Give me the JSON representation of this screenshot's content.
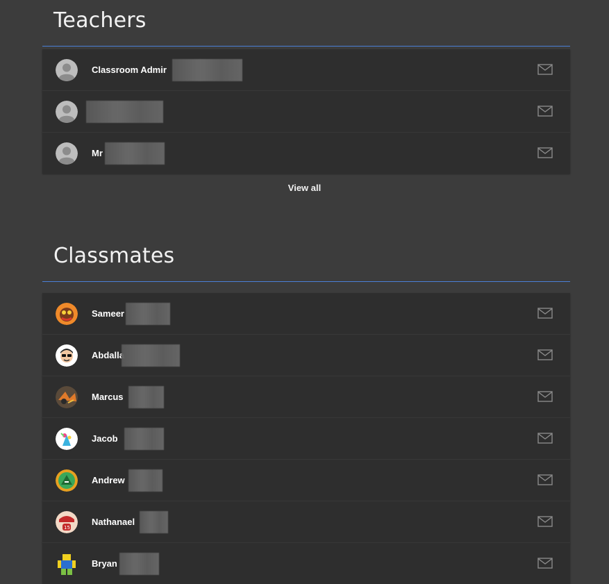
{
  "teachers": {
    "title": "Teachers",
    "items": [
      {
        "name": "Classroom Admir"
      },
      {
        "name": ""
      },
      {
        "name": "Mr"
      }
    ],
    "view_all_label": "View all"
  },
  "classmates": {
    "title": "Classmates",
    "items": [
      {
        "name": "Sameer"
      },
      {
        "name": "Abdalla"
      },
      {
        "name": "Marcus"
      },
      {
        "name": "Jacob"
      },
      {
        "name": "Andrew"
      },
      {
        "name": "Nathanael"
      },
      {
        "name": "Bryan"
      }
    ]
  },
  "colors": {
    "background": "#3c3c3c",
    "row_background": "#2e2e2e",
    "divider_accent": "#4a7fd8",
    "icon_gray": "#8a8a8a"
  },
  "icons": {
    "row_action": "mail-icon",
    "teacher_avatar": "default-person-icon"
  }
}
